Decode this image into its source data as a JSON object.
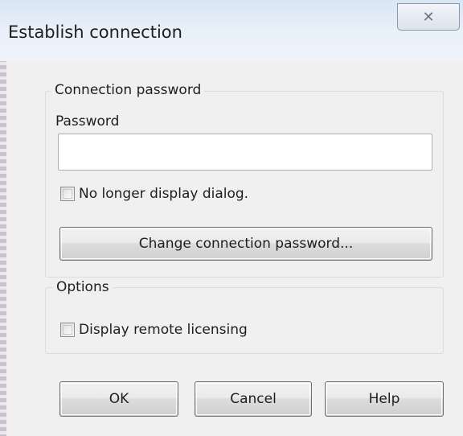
{
  "window": {
    "title": "Establish connection",
    "close_icon": "close-icon"
  },
  "connection_group": {
    "label": "Connection password",
    "password_label": "Password",
    "password_value": "",
    "no_longer_display_label": "No longer display dialog.",
    "no_longer_display_checked": false,
    "change_password_button": "Change connection password..."
  },
  "options_group": {
    "label": "Options",
    "display_remote_licensing_label": "Display remote licensing",
    "display_remote_licensing_checked": false
  },
  "buttons": {
    "ok": "OK",
    "cancel": "Cancel",
    "help": "Help"
  }
}
